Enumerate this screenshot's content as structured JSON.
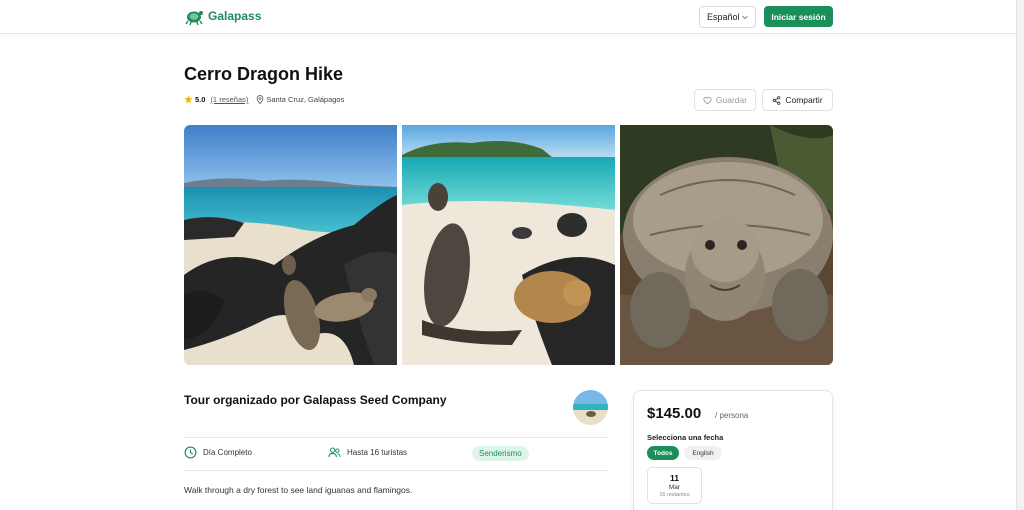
{
  "header": {
    "brand": "Galapass",
    "language": "Español",
    "login_label": "Iniciar sesión",
    "accent": "#1a8f5c"
  },
  "tour": {
    "title": "Cerro Dragon Hike",
    "rating": "5.0",
    "reviews": "(1 reseñas)",
    "location": "Santa Cruz, Galápagos",
    "save_label": "Guardar",
    "share_label": "Compartir"
  },
  "photos": [
    {
      "icon": "sea-lions-on-rocks-photo"
    },
    {
      "icon": "sea-lions-on-beach-photo"
    },
    {
      "icon": "giant-tortoise-photo"
    }
  ],
  "host": {
    "title": "Tour organizado por Galapass Seed Company"
  },
  "features": {
    "duration": "Día Completo",
    "group": "Hasta 16 turistas",
    "tag": "Senderismo"
  },
  "description": "Walk through a dry forest to see land iguanas and flamingos.",
  "booking": {
    "price": "$145.00",
    "per": "/ persona",
    "pick_label": "Selecciona una fecha",
    "filters": [
      "Todos",
      "English"
    ],
    "date": {
      "day": "11",
      "month": "Mar",
      "remaining": "16 restantes"
    }
  }
}
